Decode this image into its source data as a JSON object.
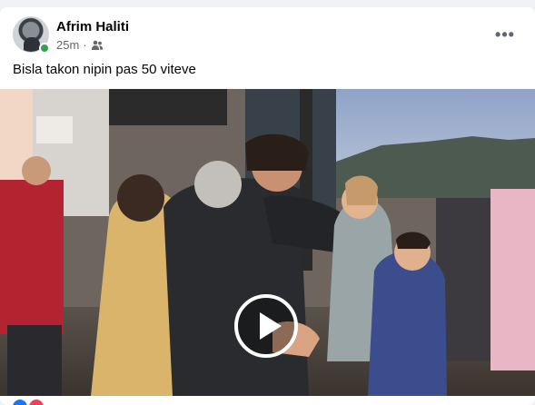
{
  "post": {
    "author": "Afrim Haliti",
    "time": "25m",
    "separator": "·",
    "audience_icon": "friends-icon",
    "more_label": "•••",
    "text": "Bisla takon nipin pas 50 viteve"
  },
  "video": {
    "play_icon": "play-icon"
  },
  "colors": {
    "online": "#31a24c",
    "reaction_like": "#1877f2",
    "reaction_love": "#f33e58"
  }
}
